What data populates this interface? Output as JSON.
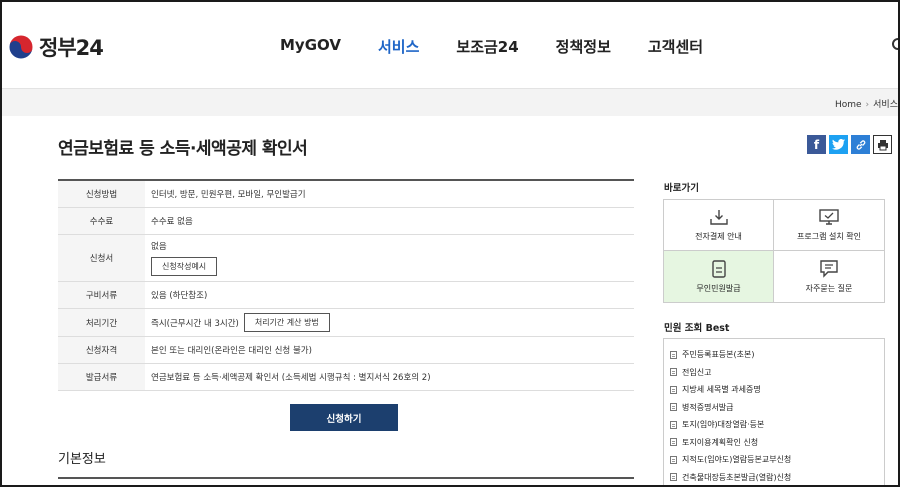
{
  "header": {
    "logo_text": "정부24",
    "nav": [
      {
        "label": "MyGOV",
        "active": false
      },
      {
        "label": "서비스",
        "active": true
      },
      {
        "label": "보조금24",
        "active": false
      },
      {
        "label": "정책정보",
        "active": false
      },
      {
        "label": "고객센터",
        "active": false
      }
    ],
    "accent_color": "#1f66c7"
  },
  "breadcrumb": {
    "home": "Home",
    "current": "서비스"
  },
  "page": {
    "title": "연금보험료 등 소득·세액공제 확인서"
  },
  "share": [
    {
      "icon": "facebook-icon",
      "glyph": "f",
      "color": "#3b5998"
    },
    {
      "icon": "twitter-icon",
      "glyph": "t",
      "color": "#1da1f2"
    },
    {
      "icon": "link-icon",
      "glyph": "🔗",
      "color": "#2d7fd6"
    },
    {
      "icon": "print-icon",
      "glyph": "⎙",
      "color": "#333333"
    }
  ],
  "info_rows": [
    {
      "label": "신청방법",
      "value": "인터넷, 방문, 민원우편, 모바일, 무인발급기"
    },
    {
      "label": "수수료",
      "value": "수수료 없음"
    },
    {
      "label": "신청서",
      "value": "없음",
      "button": "신청작성예시"
    },
    {
      "label": "구비서류",
      "value": "있음 (하단참조)"
    },
    {
      "label": "처리기간",
      "value": "즉시(근무시간 내 3시간)",
      "button": "처리기간 계산 방법"
    },
    {
      "label": "신청자격",
      "value": "본인 또는 대리인(온라인은 대리인 신청 불가)"
    },
    {
      "label": "발급서류",
      "value": "연금보험료 등 소득·세액공제 확인서 (소득세법 시행규칙 : 별지서식 26호의 2)"
    }
  ],
  "apply_button": "신청하기",
  "basic_info_title": "기본정보",
  "sidebar": {
    "quick_title": "바로가기",
    "quick_links": [
      {
        "label": "전자결제 안내",
        "icon": "payment-icon"
      },
      {
        "label": "프로그램 설치 확인",
        "icon": "monitor-icon"
      },
      {
        "label": "무인민원발급",
        "icon": "kiosk-icon"
      },
      {
        "label": "자주묻는 질문",
        "icon": "faq-icon"
      }
    ],
    "best_title": "민원 조회 Best",
    "best_items": [
      "주민등록표등본(초본)",
      "전입신고",
      "지방세 세목별 과세증명",
      "병적증명서발급",
      "토지(임야)대장열람·등본",
      "토지이용계획확인 신청",
      "지적도(임야도)열람등본교부신청",
      "건축물대장등초본발급(열람)신청"
    ]
  }
}
